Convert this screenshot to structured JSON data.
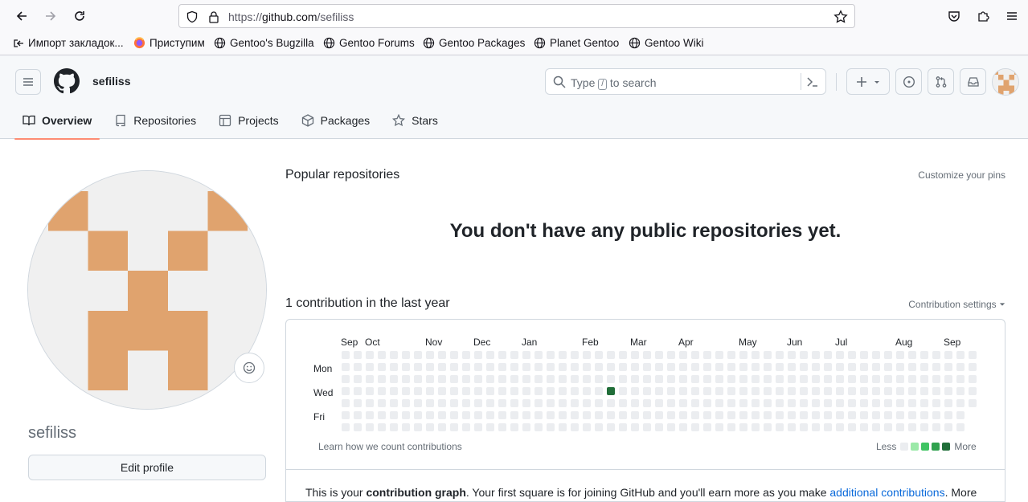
{
  "browser": {
    "url_prefix": "https://",
    "url_host": "github.com",
    "url_path": "/sefiliss",
    "bookmarks": [
      "Импорт закладок...",
      "Приступим",
      "Gentoo's Bugzilla",
      "Gentoo Forums",
      "Gentoo Packages",
      "Planet Gentoo",
      "Gentoo Wiki"
    ]
  },
  "header": {
    "username": "sefiliss",
    "search_prefix": "Type",
    "search_key": "/",
    "search_suffix": "to search",
    "plus_label": "+"
  },
  "tabs": [
    "Overview",
    "Repositories",
    "Projects",
    "Packages",
    "Stars"
  ],
  "profile": {
    "login": "sefiliss",
    "edit_label": "Edit profile",
    "avatar_color": "#e0a36e"
  },
  "main": {
    "popular_title": "Popular repositories",
    "customize_label": "Customize your pins",
    "no_repos": "You don't have any public repositories yet.",
    "contrib_title": "1 contribution in the last year",
    "contrib_settings": "Contribution settings",
    "months": [
      "Sep",
      "Oct",
      "Nov",
      "Dec",
      "Jan",
      "Feb",
      "Mar",
      "Apr",
      "May",
      "Jun",
      "Jul",
      "Aug",
      "Sep"
    ],
    "days": [
      "Mon",
      "Wed",
      "Fri"
    ],
    "learn_label": "Learn how we count contributions",
    "legend_less": "Less",
    "legend_more": "More",
    "legend_colors": [
      "#ebedf0",
      "#9be9a8",
      "#40c463",
      "#30a14e",
      "#216e39"
    ],
    "note_pre": "This is your ",
    "note_bold": "contribution graph",
    "note_mid": ". Your first square is for joining GitHub and you'll earn more as you make ",
    "note_link": "additional contributions",
    "note_post": ". More"
  },
  "contributions": {
    "weeks": 53,
    "last_week_days": 5,
    "active_week": 22,
    "active_day": 3,
    "active_level": 4
  }
}
